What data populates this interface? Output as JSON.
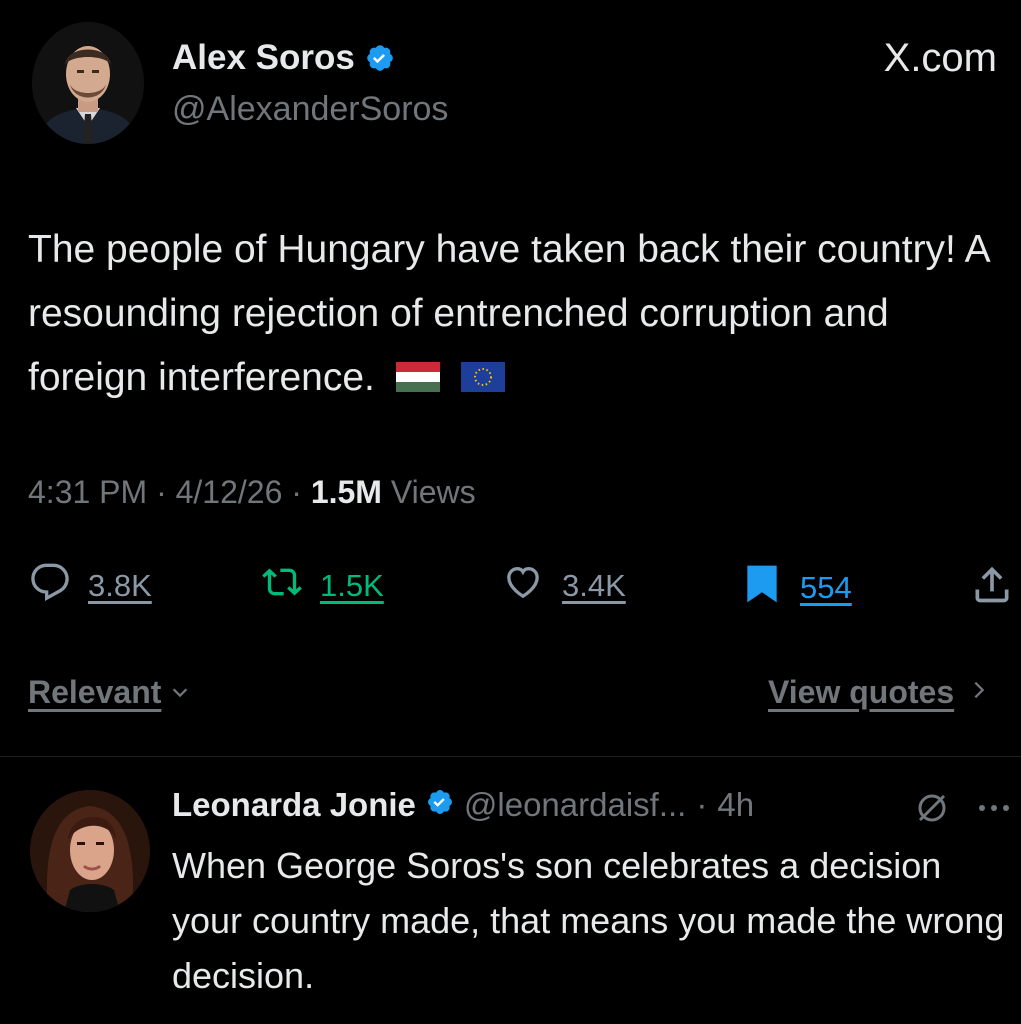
{
  "tweet": {
    "author_name": "Alex Soros",
    "author_handle": "@AlexanderSoros",
    "site_label": "X.com",
    "text": "The people of Hungary have taken back their country! A resounding rejection of entrenched corruption and foreign interference.",
    "time": "4:31 PM",
    "date": "4/12/26",
    "views_count": "1.5M",
    "views_label": "Views",
    "separator": "·",
    "actions": {
      "replies": "3.8K",
      "retweets": "1.5K",
      "likes": "3.4K",
      "bookmarks": "554"
    },
    "icons": [
      "verified-badge-icon",
      "hungary-flag-icon",
      "eu-flag-icon",
      "reply-icon",
      "retweet-icon",
      "heart-icon",
      "bookmark-icon",
      "share-icon"
    ]
  },
  "sort": {
    "label": "Relevant",
    "view_quotes_label": "View quotes"
  },
  "reply": {
    "author_name": "Leonarda Jonie",
    "author_handle": "@leonardaisf...",
    "separator": "·",
    "age": "4h",
    "text": "When George Soros's son celebrates a decision your country made, that means you made the wrong decision.",
    "icons": [
      "verified-badge-icon",
      "grok-icon",
      "more-icon"
    ]
  },
  "colors": {
    "background": "#000000",
    "text_primary": "#e7e9ea",
    "text_secondary": "#71767b",
    "verified_blue": "#1d9bf0",
    "retweet_green": "#00ba7c",
    "bookmark_blue": "#1d9bf0"
  }
}
